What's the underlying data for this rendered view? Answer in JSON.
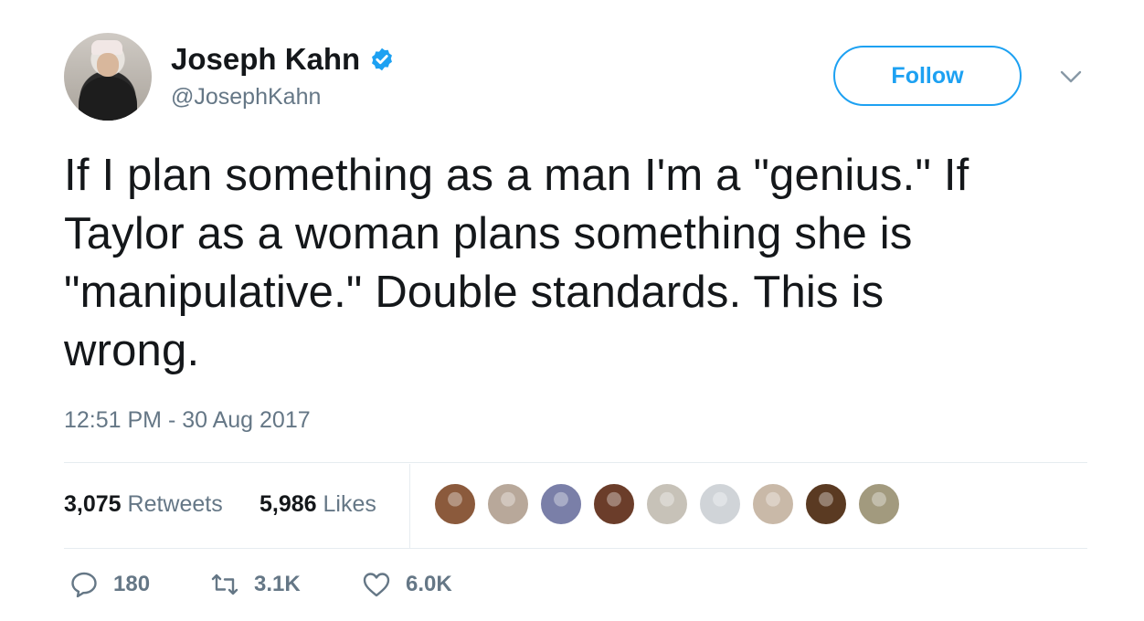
{
  "user": {
    "name": "Joseph Kahn",
    "handle": "@JosephKahn",
    "verified": true
  },
  "follow_button": {
    "label": "Follow"
  },
  "tweet": {
    "lines": [
      "If I plan something as a man I'm a \"genius.\" If",
      "Taylor as a woman plans something she is",
      "\"manipulative.\" Double standards. This is",
      "wrong."
    ],
    "timestamp": "12:51 PM - 30 Aug 2017"
  },
  "stats": {
    "retweets_count": "3,075",
    "retweets_label": "Retweets",
    "likes_count": "5,986",
    "likes_label": "Likes"
  },
  "likers": [
    {
      "color": "#8b5a3c"
    },
    {
      "color": "#b8a89a"
    },
    {
      "color": "#7a7fa8"
    },
    {
      "color": "#6b3d2a"
    },
    {
      "color": "#c7c2b8"
    },
    {
      "color": "#d0d4d8"
    },
    {
      "color": "#c9b9a8"
    },
    {
      "color": "#5a3a22"
    },
    {
      "color": "#a29a7e"
    }
  ],
  "actions": {
    "replies": "180",
    "retweets": "3.1K",
    "likes": "6.0K"
  },
  "colors": {
    "accent": "#1da1f2",
    "text": "#14171a",
    "muted": "#657786",
    "divider": "#e6ecf0"
  }
}
